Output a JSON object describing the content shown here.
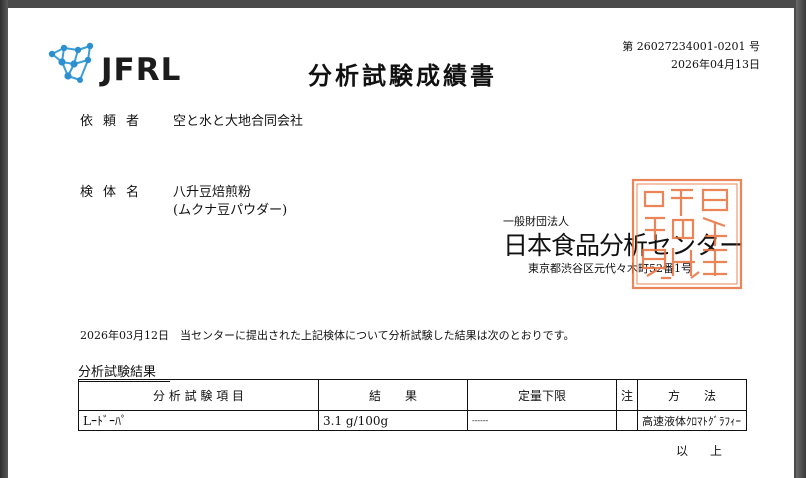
{
  "header": {
    "logo_text": "JFRL",
    "title": "分析試験成績書",
    "doc_number": "第 26027234001-0201 号",
    "doc_date": "2026年04月13日"
  },
  "client": {
    "label": "依頼者",
    "value": "空と水と大地合同会社"
  },
  "sample": {
    "label": "検体名",
    "value_line1": "八升豆焙煎粉",
    "value_line2": "(ムクナ豆パウダー)"
  },
  "issuer": {
    "sub": "一般財団法人",
    "name": "日本食品分析センター",
    "address": "東京都渋谷区元代々木町52番1号",
    "seal_color": "#e8703a"
  },
  "statement": "2026年03月12日　当センターに提出された上記検体について分析試験した結果は次のとおりです。",
  "results": {
    "section_title": "分析試験結果",
    "headers": {
      "item": "分 析 試 験 項 目",
      "result": "結　　果",
      "limit": "定量下限",
      "note": "注",
      "method": "方　　法"
    },
    "rows": [
      {
        "item": "Lｰﾄﾞｰﾊﾟ",
        "result": "3.1 g/100g",
        "limit": "------",
        "note": "",
        "method": "高速液体ｸﾛﾏﾄｸﾞﾗﾌｨｰ"
      }
    ],
    "end_mark": "以上"
  }
}
